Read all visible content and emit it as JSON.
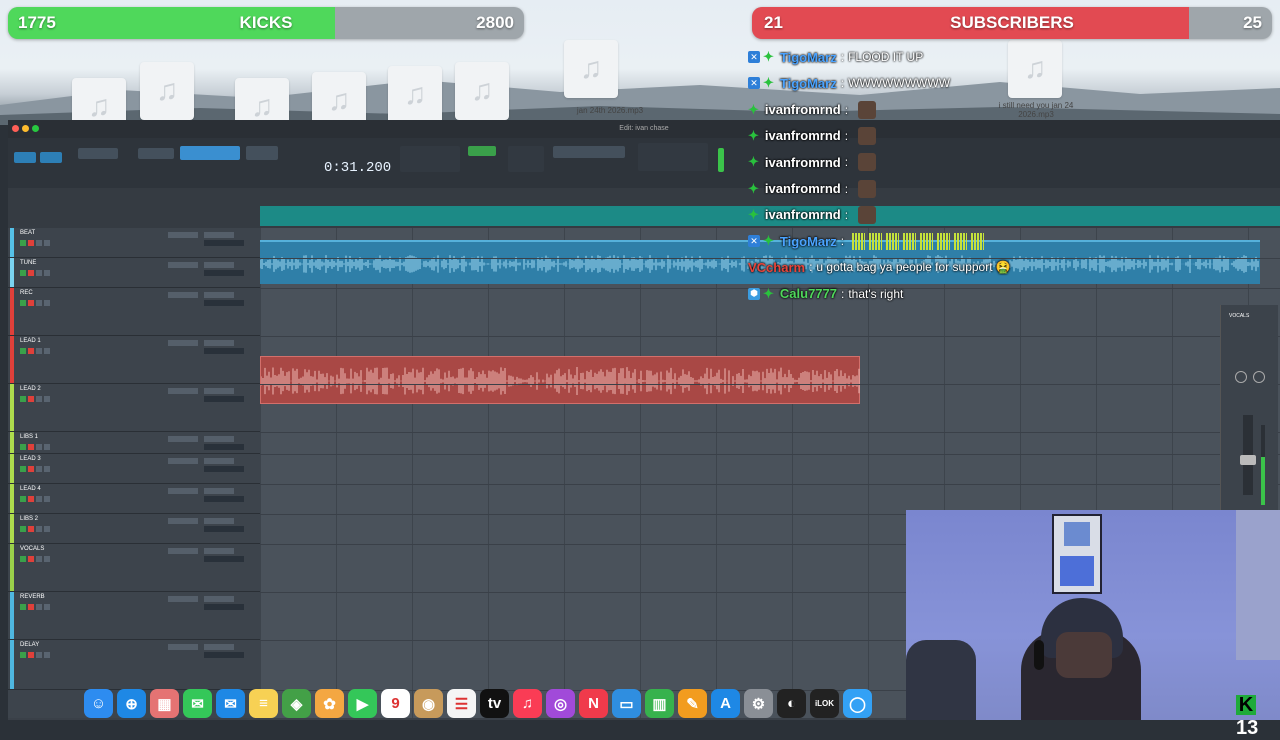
{
  "overlays": {
    "kicks_goal": {
      "current": "1775",
      "label": "KICKS",
      "target": "2800",
      "progress": 0.634,
      "fill_color": "#4fd85b"
    },
    "subs_goal": {
      "current": "21",
      "label": "SUBSCRIBERS",
      "target": "25",
      "progress": 0.84,
      "fill_color": "#e24a52"
    }
  },
  "desktop": {
    "files": [
      {
        "icon": "music-file-icon",
        "caption": ""
      },
      {
        "icon": "music-file-icon",
        "caption": ""
      },
      {
        "icon": "music-file-icon",
        "caption": ""
      },
      {
        "icon": "music-file-icon",
        "caption": ""
      },
      {
        "icon": "music-file-icon",
        "caption": ""
      },
      {
        "icon": "music-file-icon",
        "caption": ""
      },
      {
        "icon": "music-file-icon",
        "caption": ""
      },
      {
        "icon": "music-file-icon",
        "caption": "i still need you jan 24 2026.mp3"
      }
    ],
    "caption_2": "jan 24th 2026.mp3"
  },
  "pro_tools": {
    "window_title": "Edit: ivan chase",
    "counter": "0:31.200",
    "colors": {
      "timeline": "#1c8a86",
      "audio_clip": "#2f7fa8",
      "vocal_clip": "#a94845"
    },
    "tracks": [
      {
        "name": "BEAT",
        "color": "#55c1e8"
      },
      {
        "name": "TUNE",
        "color": "#7ad3f0"
      },
      {
        "name": "REC",
        "color": "#e0403a"
      },
      {
        "name": "LEAD 1",
        "color": "#e0403a"
      },
      {
        "name": "LEAD 2",
        "color": "#aedc4d"
      },
      {
        "name": "LIBS 1",
        "color": "#aedc4d"
      },
      {
        "name": "LEAD 3",
        "color": "#aedc4d"
      },
      {
        "name": "LEAD 4",
        "color": "#aedc4d"
      },
      {
        "name": "LIBS 2",
        "color": "#aedc4d"
      },
      {
        "name": "VOCALS",
        "color": "#9ad14a"
      },
      {
        "name": "REVERB",
        "color": "#4fb7e0"
      },
      {
        "name": "DELAY",
        "color": "#4fb7e0"
      }
    ],
    "mixer_strip_label": "VOCALS"
  },
  "chat": [
    {
      "user": "TigoMarz",
      "color": "#4aa3ff",
      "badges": [
        "verified",
        "sub"
      ],
      "message": "FLOOD IT UP",
      "avatar": false
    },
    {
      "user": "TigoMarz",
      "color": "#4aa3ff",
      "badges": [
        "verified",
        "sub"
      ],
      "message": "WWWWWWWWW",
      "avatar": false
    },
    {
      "user": "ivanfromrnd",
      "color": "#ffffff",
      "badges": [
        "sub"
      ],
      "message": "",
      "avatar": true
    },
    {
      "user": "ivanfromrnd",
      "color": "#ffffff",
      "badges": [
        "sub"
      ],
      "message": "",
      "avatar": true
    },
    {
      "user": "ivanfromrnd",
      "color": "#ffffff",
      "badges": [
        "sub"
      ],
      "message": "",
      "avatar": true
    },
    {
      "user": "ivanfromrnd",
      "color": "#ffffff",
      "badges": [
        "sub"
      ],
      "message": "",
      "avatar": true
    },
    {
      "user": "ivanfromrnd",
      "color": "#ffffff",
      "badges": [
        "sub"
      ],
      "message": "",
      "avatar": true
    },
    {
      "user": "TigoMarz",
      "color": "#4aa3ff",
      "badges": [
        "verified",
        "sub"
      ],
      "message": "",
      "avatar": false,
      "emote_bars": 8
    },
    {
      "user": "VCcharm",
      "color": "#e8443a",
      "badges": [],
      "message": "u gotta bag ya people for support 🤮",
      "avatar": false
    },
    {
      "user": "Calu7777",
      "color": "#4fd85b",
      "badges": [
        "shield",
        "sub"
      ],
      "message": "that's right",
      "avatar": false
    }
  ],
  "dock": {
    "apps": [
      {
        "name": "Finder",
        "icon": "finder-icon",
        "glyph": "☺",
        "color": "#2d8cf0"
      },
      {
        "name": "Safari",
        "icon": "safari-icon",
        "glyph": "⊕",
        "color": "#1e88e5"
      },
      {
        "name": "Launchpad",
        "icon": "launchpad-icon",
        "glyph": "▦",
        "color": "#e57373"
      },
      {
        "name": "Messages",
        "icon": "messages-icon",
        "glyph": "✉",
        "color": "#34c759"
      },
      {
        "name": "Mail",
        "icon": "mail-icon",
        "glyph": "✉",
        "color": "#1e88e5"
      },
      {
        "name": "Notes",
        "icon": "notes-icon",
        "glyph": "≡",
        "color": "#f7d154"
      },
      {
        "name": "Maps",
        "icon": "maps-icon",
        "glyph": "◈",
        "color": "#43a047"
      },
      {
        "name": "Photos",
        "icon": "photos-icon",
        "glyph": "✿",
        "color": "#f4a742"
      },
      {
        "name": "FaceTime",
        "icon": "facetime-icon",
        "glyph": "▶",
        "color": "#34c759"
      },
      {
        "name": "Calendar",
        "icon": "calendar-icon",
        "glyph": "9",
        "color": "#ffffff"
      },
      {
        "name": "Contacts",
        "icon": "contacts-icon",
        "glyph": "◉",
        "color": "#c79a5b"
      },
      {
        "name": "Reminders",
        "icon": "reminders-icon",
        "glyph": "☰",
        "color": "#f5f5f5"
      },
      {
        "name": "Apple TV",
        "icon": "appletv-icon",
        "glyph": "tv",
        "color": "#111111"
      },
      {
        "name": "Music",
        "icon": "music-icon",
        "glyph": "♫",
        "color": "#fa3c55"
      },
      {
        "name": "Podcasts",
        "icon": "podcasts-icon",
        "glyph": "◎",
        "color": "#a14ad9"
      },
      {
        "name": "News",
        "icon": "news-icon",
        "glyph": "N",
        "color": "#f03a4b"
      },
      {
        "name": "Keynote",
        "icon": "keynote-icon",
        "glyph": "▭",
        "color": "#2f8ee0"
      },
      {
        "name": "Numbers",
        "icon": "numbers-icon",
        "glyph": "▥",
        "color": "#37b24d"
      },
      {
        "name": "Pages",
        "icon": "pages-icon",
        "glyph": "✎",
        "color": "#f29c1f"
      },
      {
        "name": "App Store",
        "icon": "appstore-icon",
        "glyph": "A",
        "color": "#1e88e5"
      },
      {
        "name": "System Settings",
        "icon": "settings-icon",
        "glyph": "⚙",
        "color": "#8a8f96"
      },
      {
        "name": "Pro Tools",
        "icon": "protools-icon",
        "glyph": "◐",
        "color": "#222222"
      },
      {
        "name": "iLok",
        "icon": "ilok-icon",
        "glyph": "iLOK",
        "color": "#222222"
      },
      {
        "name": "Zoom",
        "icon": "zoom-icon",
        "glyph": "◯",
        "color": "#33a1f5"
      }
    ],
    "calendar_month": "FEB",
    "calendar_day": "9"
  },
  "corner_number": "13"
}
